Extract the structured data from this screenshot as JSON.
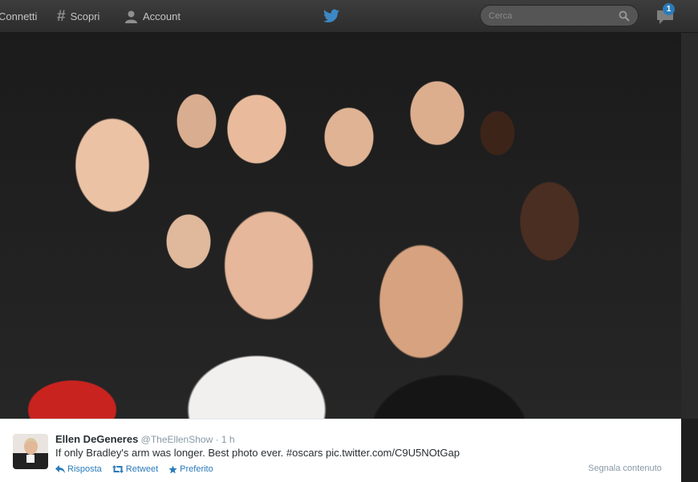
{
  "topbar": {
    "nav": [
      {
        "label": "Connetti",
        "icon": "connect-icon"
      },
      {
        "label": "Scopri",
        "icon": "hashtag-icon"
      },
      {
        "label": "Account",
        "icon": "person-icon"
      }
    ],
    "logo": "twitter-bird-icon",
    "search": {
      "placeholder": "Cerca",
      "value": ""
    },
    "messages": {
      "icon": "messages-icon",
      "badge": "1"
    }
  },
  "photo": {
    "description_icon": "group-selfie-photo"
  },
  "tweet": {
    "fullname": "Ellen DeGeneres",
    "handle": "@TheEllenShow",
    "separator": "·",
    "time": "1 h",
    "text": "If only Bradley's arm was longer. Best photo ever. #oscars pic.twitter.com/C9U5NOtGap",
    "actions": {
      "reply": "Risposta",
      "retweet": "Retweet",
      "favorite": "Preferito"
    },
    "report": "Segnala contenuto"
  },
  "colors": {
    "accent": "#2b7bb9",
    "topbar": "#333333",
    "muted": "#8899a6"
  }
}
